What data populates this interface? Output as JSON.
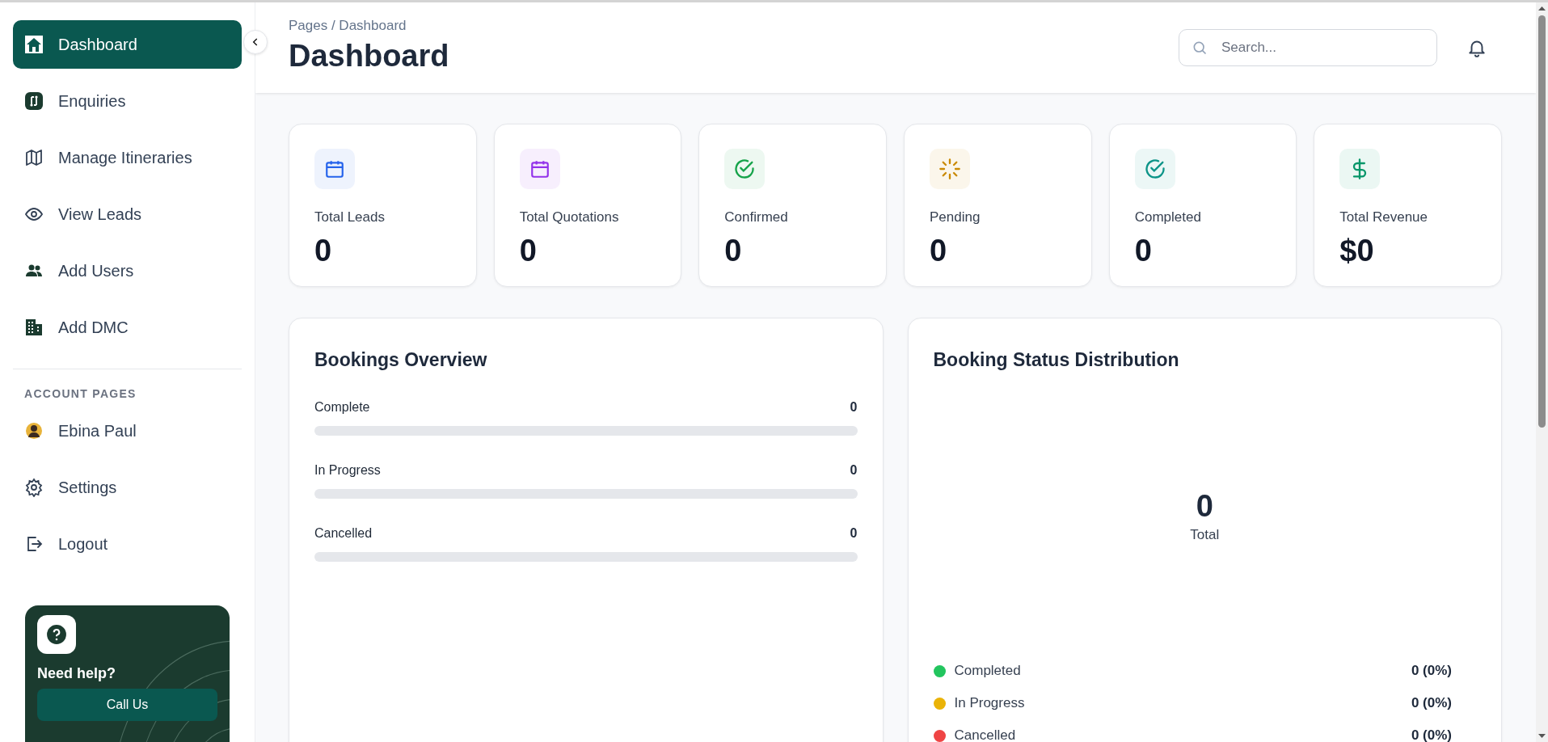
{
  "sidebar": {
    "nav": [
      {
        "label": "Dashboard",
        "kind": "home",
        "selected": true
      },
      {
        "label": "Enquiries",
        "kind": "enquiry",
        "selected": false
      },
      {
        "label": "Manage Itineraries",
        "kind": "map",
        "selected": false
      },
      {
        "label": "View Leads",
        "kind": "eye",
        "selected": false
      },
      {
        "label": "Add Users",
        "kind": "users",
        "selected": false
      },
      {
        "label": "Add DMC",
        "kind": "building",
        "selected": false
      }
    ],
    "section_title": "ACCOUNT PAGES",
    "account": [
      {
        "label": "Ebina Paul",
        "kind": "avatar",
        "selected": false
      },
      {
        "label": "Settings",
        "kind": "gear",
        "selected": false
      },
      {
        "label": "Logout",
        "kind": "logout",
        "selected": false
      }
    ],
    "help": {
      "title": "Need help?",
      "button": "Call Us"
    }
  },
  "header": {
    "breadcrumb": "Pages / Dashboard",
    "title": "Dashboard",
    "search": {
      "placeholder": "Search..."
    }
  },
  "stats": [
    {
      "label": "Total Leads",
      "value": "0",
      "kind": "calendar",
      "color": "#2563eb"
    },
    {
      "label": "Total Quotations",
      "value": "0",
      "kind": "calendar",
      "color": "#9333ea"
    },
    {
      "label": "Confirmed",
      "value": "0",
      "kind": "check",
      "color": "#16a34a"
    },
    {
      "label": "Pending",
      "value": "0",
      "kind": "loader",
      "color": "#ca8a04"
    },
    {
      "label": "Completed",
      "value": "0",
      "kind": "check",
      "color": "#0d9488"
    },
    {
      "label": "Total Revenue",
      "value": "$0",
      "kind": "dollar",
      "color": "#059669"
    }
  ],
  "bookings_overview": {
    "title": "Bookings Overview",
    "rows": [
      {
        "label": "Complete",
        "value": "0",
        "level": 0
      },
      {
        "label": "In Progress",
        "value": "0",
        "level": 0
      },
      {
        "label": "Cancelled",
        "value": "0",
        "level": 0
      }
    ]
  },
  "status_distribution": {
    "title": "Booking Status Distribution",
    "total": "0",
    "total_label": "Total",
    "legend": [
      {
        "label": "Completed",
        "value": "0 (0%)",
        "color": "#22c55e"
      },
      {
        "label": "In Progress",
        "value": "0 (0%)",
        "color": "#eab308"
      },
      {
        "label": "Cancelled",
        "value": "0 (0%)",
        "color": "#ef4444"
      }
    ]
  }
}
